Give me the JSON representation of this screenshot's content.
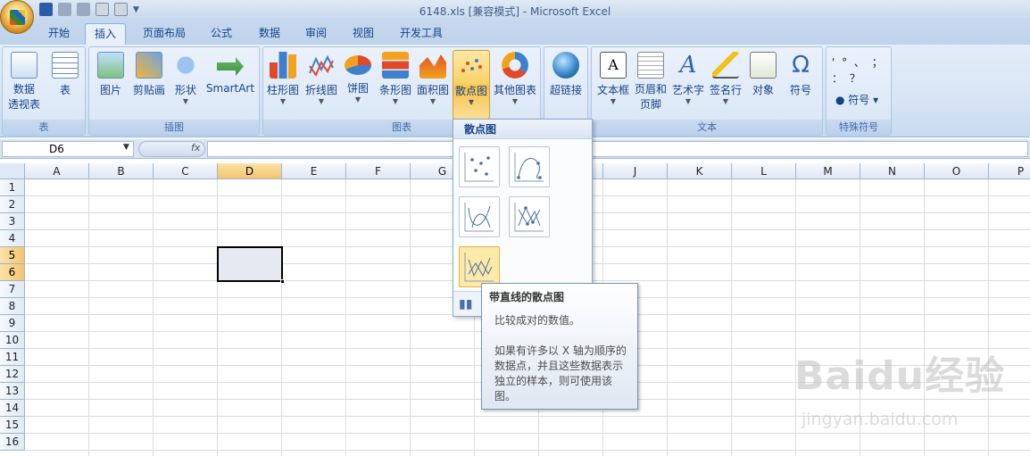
{
  "window": {
    "title": "6148.xls  [兼容模式] - Microsoft Excel"
  },
  "tabs": [
    "开始",
    "插入",
    "页面布局",
    "公式",
    "数据",
    "审阅",
    "视图",
    "开发工具"
  ],
  "active_tab": "插入",
  "ribbon": {
    "groups": {
      "table": {
        "label": "表",
        "buttons": [
          "数据\n透视表",
          "表"
        ]
      },
      "illustrations": {
        "label": "插图",
        "buttons": [
          "图片",
          "剪贴画",
          "形状",
          "SmartArt"
        ]
      },
      "charts": {
        "label": "图表",
        "buttons": [
          "柱形图",
          "折线图",
          "饼图",
          "条形图",
          "面积图",
          "散点图",
          "其他图表"
        ]
      },
      "links": {
        "buttons": [
          "超链接"
        ]
      },
      "text": {
        "label": "文本",
        "buttons": [
          "文本框",
          "页眉和\n页脚",
          "艺术字",
          "签名行",
          "对象"
        ]
      },
      "symbols": {
        "buttons": [
          "符号"
        ]
      },
      "special": {
        "label": "特殊符号",
        "symbol_label": "符号",
        "chars": "' ° 、 ； ： ？"
      }
    }
  },
  "formula_bar": {
    "name_box": "D6",
    "fx": "fx",
    "value": ""
  },
  "columns": [
    "A",
    "B",
    "C",
    "D",
    "E",
    "F",
    "G",
    "H",
    "I",
    "J",
    "K",
    "L",
    "M",
    "N",
    "O",
    "P"
  ],
  "rows": [
    "1",
    "2",
    "3",
    "4",
    "5",
    "6",
    "7",
    "8",
    "9",
    "10",
    "11",
    "12",
    "13",
    "14",
    "15",
    "16"
  ],
  "selected_column": "D",
  "selected_rows": [
    "5",
    "6"
  ],
  "dropdown": {
    "title": "散点图"
  },
  "tooltip": {
    "title": "带直线的散点图",
    "line1": "比较成对的数值。",
    "line2": "如果有许多以 X 轴为顺序的数据点，并且这些数据表示独立的样本，则可使用该图。"
  },
  "watermark": {
    "big": "Baidu经验",
    "small": "jingyan.baidu.com"
  }
}
